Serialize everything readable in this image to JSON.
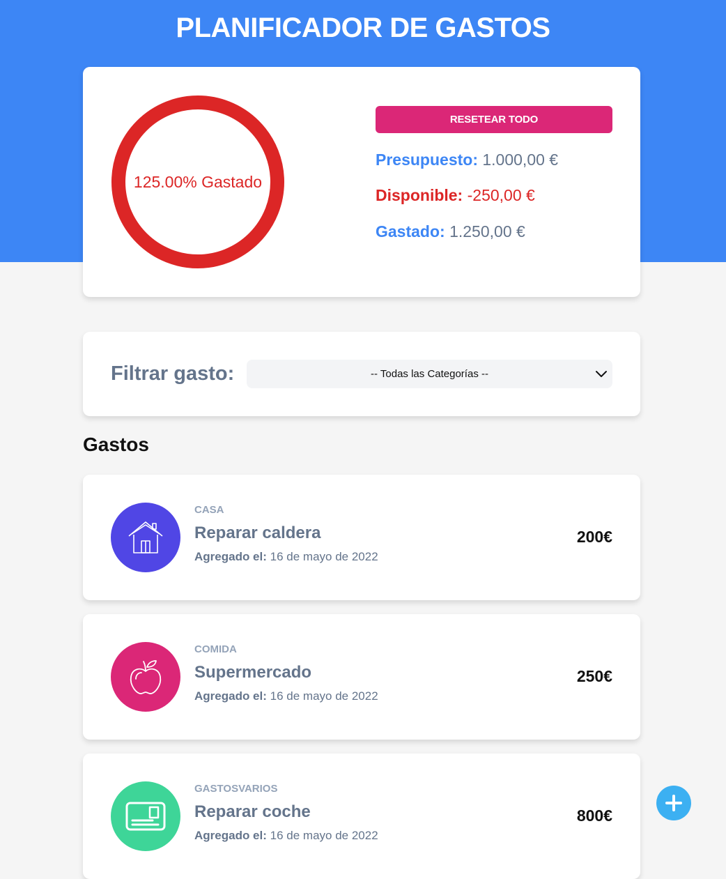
{
  "header": {
    "title": "PLANIFICADOR DE GASTOS"
  },
  "budget": {
    "percent_spent_label": "125.00% Gastado",
    "percent_spent": 125,
    "reset_label": "RESETEAR TODO",
    "presupuesto_label": "Presupuesto:",
    "presupuesto_value": "1.000,00 €",
    "disponible_label": "Disponible:",
    "disponible_value": "-250,00 €",
    "gastado_label": "Gastado:",
    "gastado_value": "1.250,00 €"
  },
  "filter": {
    "label": "Filtrar gasto:",
    "selected": "-- Todas las Categorías --"
  },
  "expenses_section": {
    "title": "Gastos"
  },
  "expenses": [
    {
      "category": "CASA",
      "name": "Reparar caldera",
      "date_label": "Agregado el:",
      "date": "16 de mayo de 2022",
      "amount": "200€",
      "icon": "house-icon",
      "color": "#5046e5"
    },
    {
      "category": "COMIDA",
      "name": "Supermercado",
      "date_label": "Agregado el:",
      "date": "16 de mayo de 2022",
      "amount": "250€",
      "icon": "apple-icon",
      "color": "#db2777"
    },
    {
      "category": "GASTOSVARIOS",
      "name": "Reparar coche",
      "date_label": "Agregado el:",
      "date": "16 de mayo de 2022",
      "amount": "800€",
      "icon": "card-icon",
      "color": "#3ed598"
    }
  ],
  "colors": {
    "primary": "#3d86f5",
    "danger": "#dc2626",
    "accent": "#db2777",
    "fab": "#3cb0f2"
  }
}
